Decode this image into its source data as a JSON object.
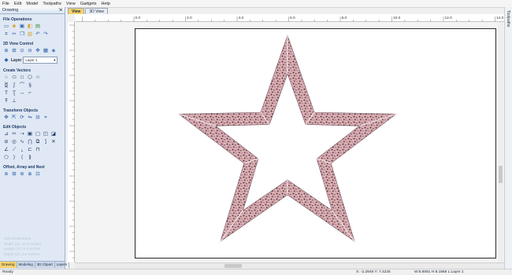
{
  "menu": [
    "File",
    "Edit",
    "Model",
    "Toolpaths",
    "View",
    "Gadgets",
    "Help"
  ],
  "panel": {
    "title": "Drawing",
    "pin": "⇲",
    "sections": {
      "file_ops": "File Operations",
      "view_control": "2D View Control",
      "create_vectors": "Create Vectors",
      "transform": "Transform Objects",
      "edit": "Edit Objects",
      "offset": "Offset, Array and Nest"
    },
    "layer_label": "Layer",
    "layer_value": "Layer 1"
  },
  "job": {
    "title": "Job Dimensions",
    "width": "Width  (X): 17.0 Inches",
    "height": "Height (Y): 6.0 Inches",
    "depth": "Depth  (Z): 0.5 Inches"
  },
  "bottom_tabs": [
    "Drawing",
    "Modeling",
    "3D Clipart",
    "Layers"
  ],
  "view_tabs": [
    "View",
    "3D View"
  ],
  "ruler_labels": [
    "0.0",
    "2.0",
    "4.0",
    "6.0",
    "8.0",
    "10.0",
    "12.0",
    "14.0"
  ],
  "right_tab": "Toolpaths",
  "status": {
    "ready": "Ready",
    "coords": "X: -2.2949 Y: 7.4225",
    "dims": "W:8.8081  H:8.1868  L:Layer 1"
  },
  "colors": {
    "panel_bg": "#dfe8f4",
    "accent_tab": "#f7d36c",
    "star_fill": "#d7a8ad",
    "star_texture": "#3b2f36"
  }
}
